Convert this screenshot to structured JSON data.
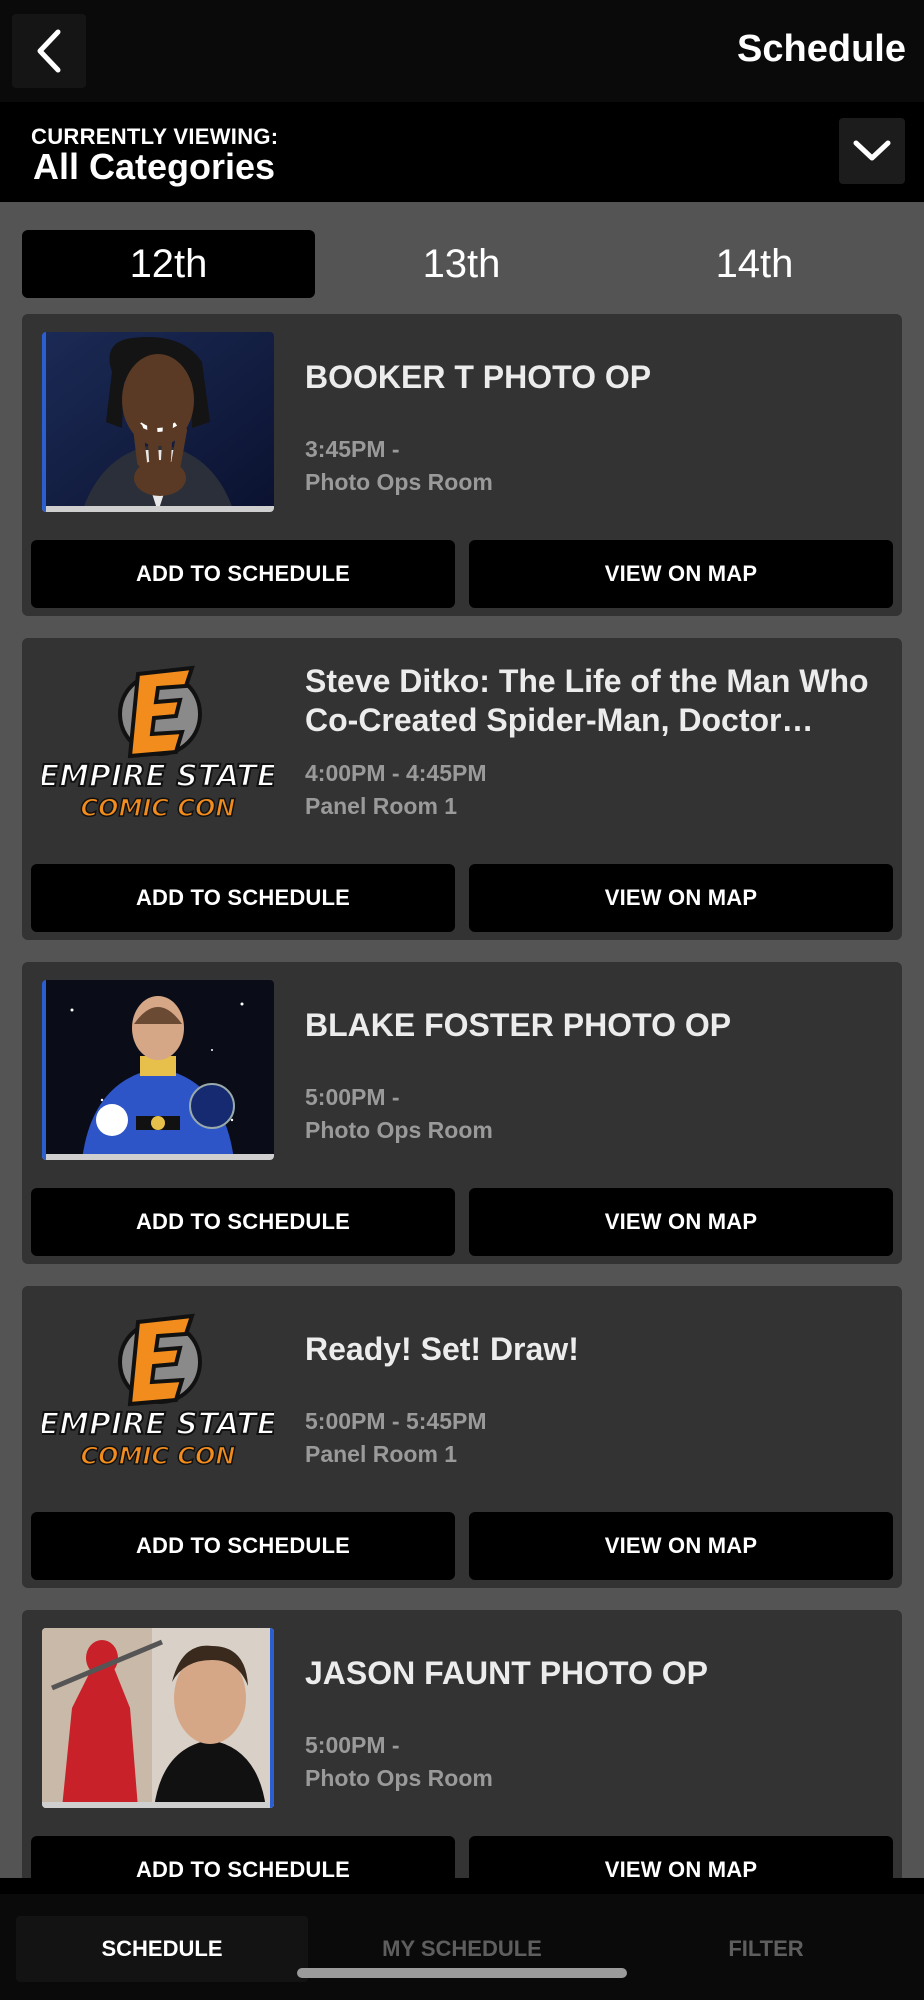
{
  "header": {
    "title": "Schedule",
    "back_icon": "chevron-left-icon"
  },
  "category": {
    "label": "CURRENTLY VIEWING:",
    "value": "All Categories",
    "dropdown_icon": "chevron-down-icon"
  },
  "days": [
    {
      "label": "12th",
      "active": true
    },
    {
      "label": "13th",
      "active": false
    },
    {
      "label": "14th",
      "active": false
    }
  ],
  "events": [
    {
      "title": "BOOKER T PHOTO OP",
      "time": "3:45PM -",
      "location": "Photo Ops Room",
      "image": "booker-t-photo",
      "add_label": "ADD TO SCHEDULE",
      "map_label": "VIEW ON MAP"
    },
    {
      "title": "Steve Ditko: The Life of the Man Who Co-Created Spider-Man, Doctor Strange and More",
      "time": "4:00PM - 4:45PM",
      "location": "Panel Room 1",
      "image": "empire-state-comic-con-logo",
      "logo_text_1": "EMPIRE STATE",
      "logo_text_2": "COMIC CON",
      "add_label": "ADD TO SCHEDULE",
      "map_label": "VIEW ON MAP"
    },
    {
      "title": "BLAKE FOSTER PHOTO OP",
      "time": "5:00PM -",
      "location": "Photo Ops Room",
      "image": "blake-foster-photo",
      "add_label": "ADD TO SCHEDULE",
      "map_label": "VIEW ON MAP"
    },
    {
      "title": "Ready! Set! Draw!",
      "time": "5:00PM - 5:45PM",
      "location": "Panel Room 1",
      "image": "empire-state-comic-con-logo",
      "logo_text_1": "EMPIRE STATE",
      "logo_text_2": "COMIC CON",
      "add_label": "ADD TO SCHEDULE",
      "map_label": "VIEW ON MAP"
    },
    {
      "title": "JASON FAUNT PHOTO OP",
      "time": "5:00PM -",
      "location": "Photo Ops Room",
      "image": "jason-faunt-photo",
      "add_label": "ADD TO SCHEDULE",
      "map_label": "VIEW ON MAP"
    }
  ],
  "bottom_tabs": [
    {
      "label": "SCHEDULE",
      "active": true
    },
    {
      "label": "MY SCHEDULE",
      "active": false
    },
    {
      "label": "FILTER",
      "active": false
    }
  ],
  "colors": {
    "background": "#545454",
    "card": "#333333",
    "button": "#000000",
    "logo_orange": "#f28c1c"
  }
}
